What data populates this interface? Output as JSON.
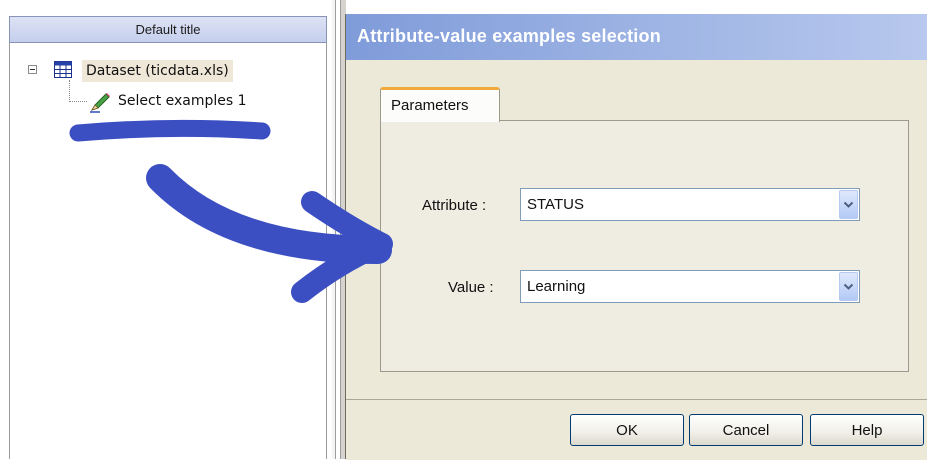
{
  "tree": {
    "header": "Default title",
    "dataset_label": "Dataset (ticdata.xls)",
    "child_label": "Select examples 1"
  },
  "dialog": {
    "title": "Attribute-value examples selection",
    "tab_label": "Parameters",
    "attribute_label": "Attribute :",
    "attribute_value": "STATUS",
    "value_label": "Value :",
    "value_value": "Learning",
    "ok_label": "OK",
    "cancel_label": "Cancel",
    "help_label": "Help"
  },
  "icons": {
    "expander": "collapse-minus-icon",
    "dataset": "table-grid-icon",
    "component": "pencil-icon",
    "dropdown": "chevron-down-icon"
  },
  "colors": {
    "title_bar": "#7f9bd9",
    "tab_accent": "#f1a93a",
    "annotation_ink": "#3b4fc2",
    "dialog_bg": "#ece9d8"
  }
}
